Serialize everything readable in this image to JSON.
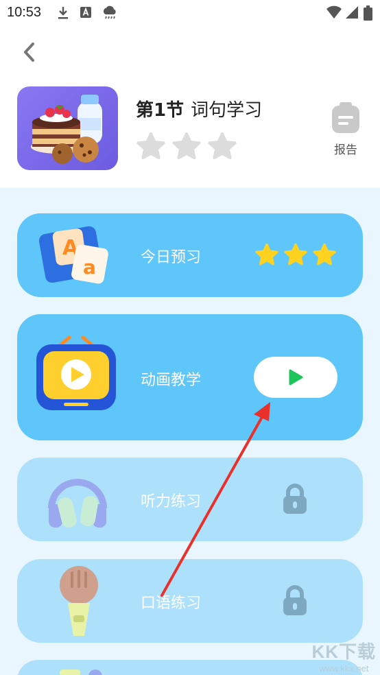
{
  "status_bar": {
    "time": "10:53",
    "icons": [
      "download-icon",
      "a-notification-icon",
      "cloud-rain-icon",
      "wifi-icon",
      "cellular-icon",
      "battery-icon"
    ]
  },
  "header": {
    "lesson_number": "第1节",
    "lesson_name": "词句学习",
    "stars_earned": 0,
    "stars_total": 3,
    "report_label": "报告"
  },
  "activities": [
    {
      "label": "今日预习",
      "status": "completed",
      "stars_earned": 3,
      "stars_total": 3
    },
    {
      "label": "动画教学",
      "status": "current",
      "action": "play"
    },
    {
      "label": "听力练习",
      "status": "locked"
    },
    {
      "label": "口语练习",
      "status": "locked"
    }
  ],
  "colors": {
    "card_active": "#5fc6fa",
    "card_locked": "#ade1fb",
    "content_bg": "#e9f6fe",
    "star_gold": "#ffd21f",
    "star_empty": "#dcdcdc",
    "play_green": "#1fc45a",
    "arrow_red": "#e8312a"
  },
  "watermark": {
    "line1": "KK下载",
    "line2": "www.kkx.net"
  }
}
